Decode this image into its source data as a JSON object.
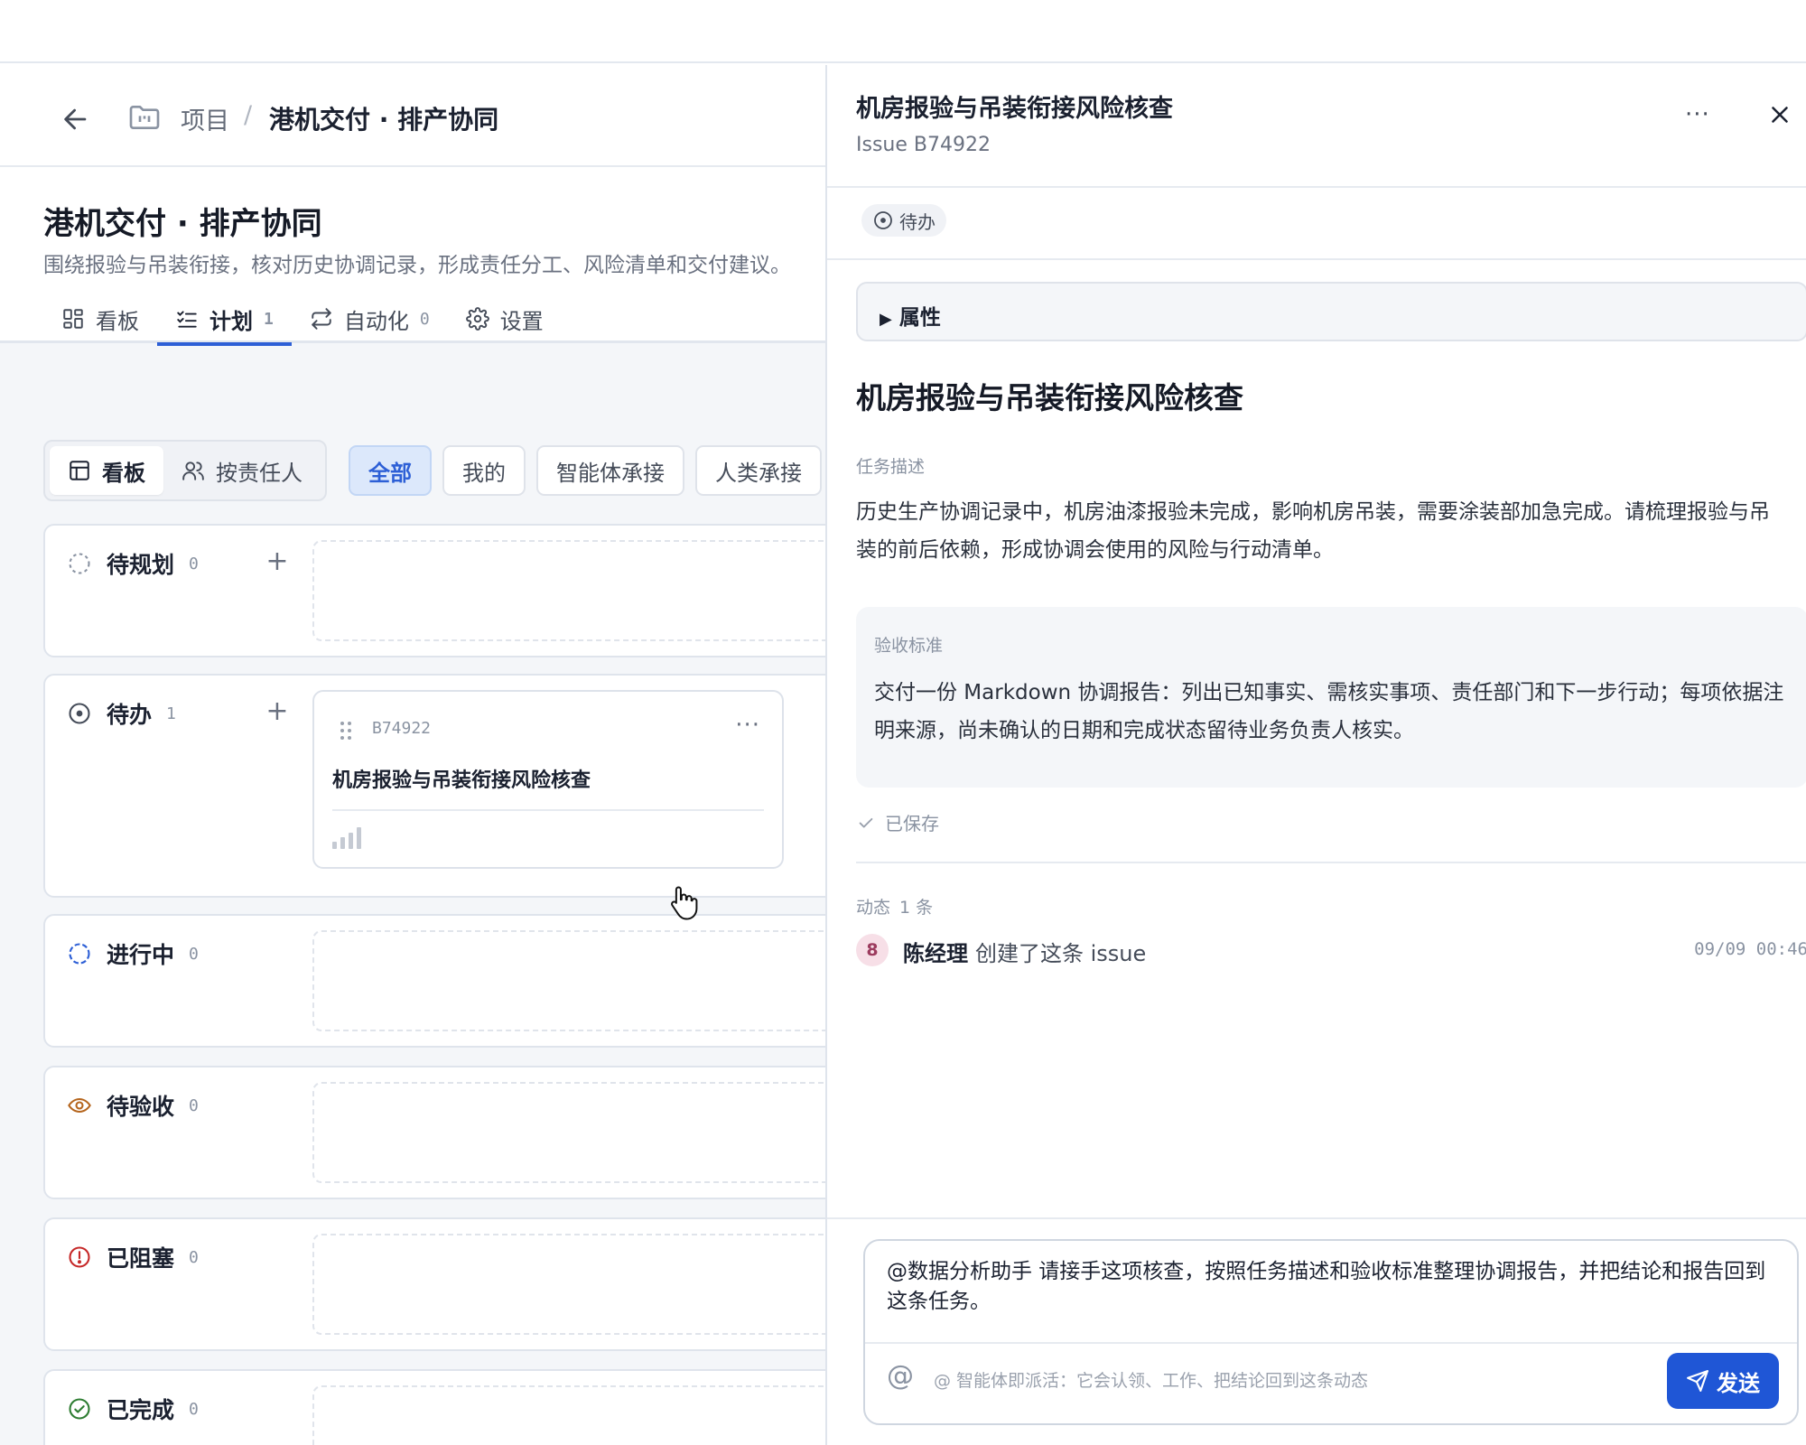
{
  "breadcrumb": {
    "root": "项目",
    "separator": "/",
    "current": "港机交付 · 排产协同"
  },
  "project": {
    "title": "港机交付 · 排产协同",
    "description": "围绕报验与吊装衔接，核对历史协调记录，形成责任分工、风险清单和交付建议。"
  },
  "tabs": [
    {
      "label": "看板",
      "icon": "board-icon",
      "count": ""
    },
    {
      "label": "计划",
      "icon": "checklist-icon",
      "count": "1",
      "active": true
    },
    {
      "label": "自动化",
      "icon": "repeat-icon",
      "count": "0"
    },
    {
      "label": "设置",
      "icon": "gear-icon",
      "count": ""
    }
  ],
  "view_switch": [
    {
      "label": "看板",
      "icon": "layout-icon",
      "active": true
    },
    {
      "label": "按责任人",
      "icon": "people-icon"
    }
  ],
  "filters": [
    {
      "label": "全部",
      "active": true
    },
    {
      "label": "我的"
    },
    {
      "label": "智能体承接"
    },
    {
      "label": "人类承接"
    }
  ],
  "groups": [
    {
      "label": "待规划",
      "count": "0",
      "icon": "dashed-circle-icon",
      "color": "#8a93a2"
    },
    {
      "label": "待办",
      "count": "1",
      "icon": "todo-circle-icon",
      "color": "#454c59"
    },
    {
      "label": "进行中",
      "count": "0",
      "icon": "in-progress-icon",
      "color": "#2d5fd6"
    },
    {
      "label": "待验收",
      "count": "0",
      "icon": "eye-icon",
      "color": "#b5651d"
    },
    {
      "label": "已阻塞",
      "count": "0",
      "icon": "alert-icon",
      "color": "#c62828"
    },
    {
      "label": "已完成",
      "count": "0",
      "icon": "check-circle-icon",
      "color": "#2e7d32"
    }
  ],
  "card": {
    "id": "B74922",
    "title": "机房报验与吊装衔接风险核查",
    "priority_icon": "priority-bars-icon"
  },
  "detail": {
    "title": "机房报验与吊装衔接风险核查",
    "issue_id": "Issue B74922",
    "status": "待办",
    "properties_label": "属性",
    "heading": "机房报验与吊装衔接风险核查",
    "desc_label": "任务描述",
    "description": "历史生产协调记录中，机房油漆报验未完成，影响机房吊装，需要涂装部加急完成。请梳理报验与吊装的前后依赖，形成协调会使用的风险与行动清单。",
    "acceptance_label": "验收标准",
    "acceptance": "交付一份 Markdown 协调报告：列出已知事实、需核实事项、责任部门和下一步行动；每项依据注明来源，尚未确认的日期和完成状态留待业务负责人核实。",
    "saved": "已保存",
    "activity_label": "动态",
    "activity_count": "1 条",
    "activity": {
      "avatar": "8",
      "who": "陈经理",
      "what": "创建了这条 issue",
      "time": "09/09 00:46"
    },
    "composer_text": "@数据分析助手 请接手这项核查，按照任务描述和验收标准整理协调报告，并把结论和报告回到这条任务。",
    "composer_hint": "@ 智能体即派活：它会认领、工作、把结论回到这条动态",
    "send_label": "发送",
    "accent": "#1f56d6"
  }
}
